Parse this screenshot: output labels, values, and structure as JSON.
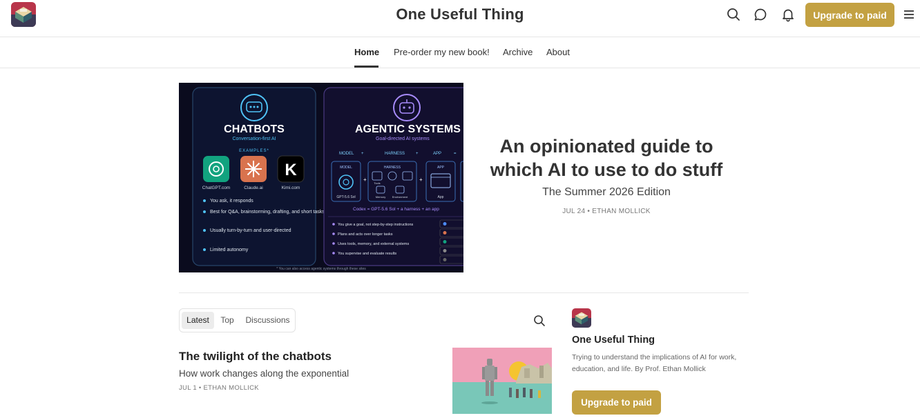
{
  "header": {
    "site_title": "One Useful Thing",
    "icons": [
      "search-icon",
      "chat-icon",
      "bell-icon",
      "menu-icon"
    ],
    "upgrade_label": "Upgrade to paid"
  },
  "nav": {
    "items": [
      {
        "label": "Home",
        "active": true
      },
      {
        "label": "Pre-order my new book!",
        "active": false
      },
      {
        "label": "Archive",
        "active": false
      },
      {
        "label": "About",
        "active": false
      }
    ]
  },
  "hero": {
    "image": {
      "left_panel": {
        "title": "CHATBOTS",
        "subtitle": "Conversation-first AI",
        "examples_label": "EXAMPLES*",
        "apps": [
          "ChatGPT.com",
          "Claude.ai",
          "Kimi.com"
        ],
        "bullets": [
          "You ask, it responds",
          "Best for Q&A, brainstorming, drafting, and short tasks",
          "Usually turn-by-turn and user-directed",
          "Limited autonomy"
        ]
      },
      "right_panel": {
        "title": "AGENTIC SYSTEMS",
        "subtitle": "Goal-directed AI systems",
        "formula": [
          "MODEL",
          "+",
          "HARNESS",
          "+",
          "APP",
          "="
        ],
        "model_caption": "GPT-5.6 Sol",
        "harness_items": [
          "Tools",
          "Memory",
          "Environment"
        ],
        "app_caption": "App",
        "equation": "Codex = GPT-5.6 Sol + a harness + an app",
        "bullets": [
          "You give a goal, not step-by-step instructions",
          "Plans and acts over longer tasks",
          "Uses tools, memory, and external systems",
          "You supervise and evaluate results"
        ]
      },
      "footnote": "* You can also access agentic systems through these sites"
    },
    "title": "An opinionated guide to which AI to use to do stuff",
    "subtitle": "The Summer 2026 Edition",
    "meta": "JUL 24 • ETHAN MOLLICK"
  },
  "tabs": {
    "items": [
      {
        "label": "Latest",
        "active": true
      },
      {
        "label": "Top",
        "active": false
      },
      {
        "label": "Discussions",
        "active": false
      }
    ]
  },
  "post": {
    "title": "The twilight of the chatbots",
    "subtitle": "How work changes along the exponential",
    "meta": "JUL 1 • ETHAN MOLLICK"
  },
  "sidebar": {
    "title": "One Useful Thing",
    "description": "Trying to understand the implications of AI for work, education, and life. By Prof. Ethan Mollick",
    "upgrade_label": "Upgrade to paid"
  },
  "colors": {
    "accent": "#c3a142",
    "hero_bg": "#0a0b1e",
    "chatbot_cyan": "#4fc3f7",
    "agentic_purple": "#a78bfa"
  }
}
